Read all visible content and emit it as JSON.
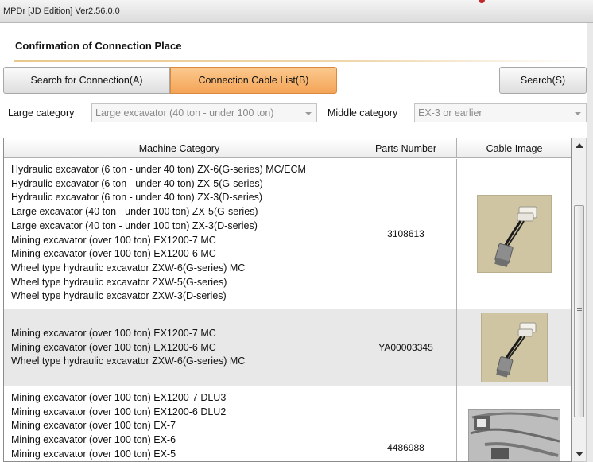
{
  "window": {
    "title": "MPDr [JD Edition] Ver2.56.0.0"
  },
  "page": {
    "heading": "Confirmation of Connection Place"
  },
  "tabs": {
    "search_label": "Search for Connection(A)",
    "cable_list_label": "Connection Cable List(B)"
  },
  "toolbar": {
    "search_button": "Search(S)"
  },
  "filters": {
    "large_category_label": "Large category",
    "large_category_value": "Large excavator (40 ton - under 100 ton)",
    "middle_category_label": "Middle category",
    "middle_category_value": "EX-3 or earlier"
  },
  "table": {
    "columns": [
      "Machine Category",
      "Parts Number",
      "Cable Image"
    ],
    "rows": [
      {
        "machines": [
          "Hydraulic excavator (6 ton - under 40 ton) ZX-6(G-series) MC/ECM",
          "Hydraulic excavator (6 ton - under 40 ton) ZX-5(G-series)",
          "Hydraulic excavator (6 ton - under 40 ton) ZX-3(D-series)",
          "Large excavator (40 ton - under 100 ton) ZX-5(G-series)",
          "Large excavator (40 ton - under 100 ton) ZX-3(D-series)",
          "Mining excavator (over 100 ton) EX1200-7 MC",
          "Mining excavator (over 100 ton) EX1200-6 MC",
          "Wheel type hydraulic excavator ZXW-6(G-series) MC",
          "Wheel type hydraulic excavator ZXW-5(G-series)",
          "Wheel type hydraulic excavator ZXW-3(D-series)"
        ],
        "parts_number": "3108613"
      },
      {
        "machines": [
          "Mining excavator (over 100 ton) EX1200-7 MC",
          "Mining excavator (over 100 ton) EX1200-6 MC",
          "Wheel type hydraulic excavator ZXW-6(G-series) MC"
        ],
        "parts_number": "YA00003345"
      },
      {
        "machines": [
          "Mining excavator (over 100 ton) EX1200-7 DLU3",
          "Mining excavator (over 100 ton) EX1200-6 DLU2",
          "Mining excavator (over 100 ton) EX-7",
          "Mining excavator (over 100 ton) EX-6",
          "Mining excavator (over 100 ton) EX-5"
        ],
        "parts_number": "4486988"
      }
    ]
  },
  "colors": {
    "active_tab": "#f4a457",
    "heading_rule": "#e9c88c",
    "selected_row": "#e8e8e8"
  }
}
